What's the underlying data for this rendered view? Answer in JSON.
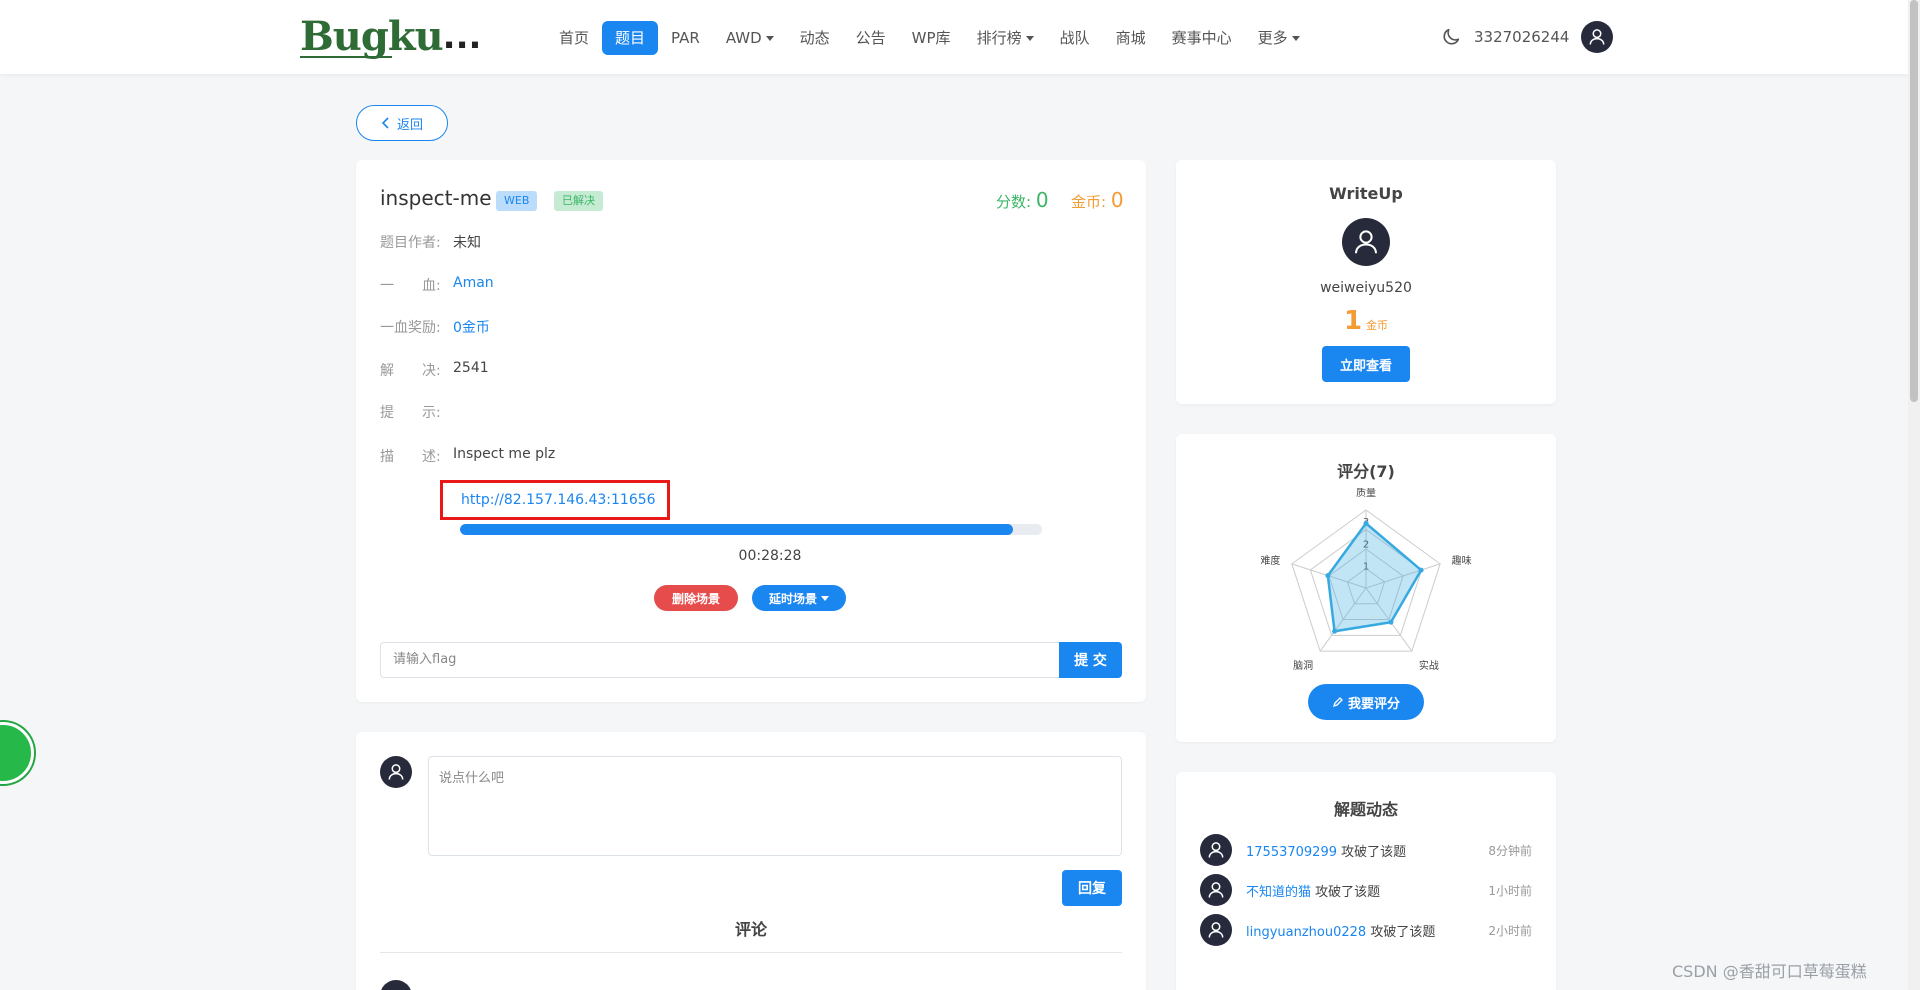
{
  "nav": {
    "logo_text": "Bugku",
    "logo_suffix": "...",
    "items": [
      {
        "label": "首页"
      },
      {
        "label": "题目",
        "active": true
      },
      {
        "label": "PAR"
      },
      {
        "label": "AWD",
        "dropdown": true
      },
      {
        "label": "动态"
      },
      {
        "label": "公告"
      },
      {
        "label": "WP库"
      },
      {
        "label": "排行榜",
        "dropdown": true
      },
      {
        "label": "战队"
      },
      {
        "label": "商城"
      },
      {
        "label": "赛事中心"
      },
      {
        "label": "更多",
        "dropdown": true
      }
    ],
    "username": "3327026244"
  },
  "back_label": "返回",
  "challenge": {
    "title": "inspect-me",
    "category_badge": "WEB",
    "status_badge": "已解决",
    "points_label": "分数: ",
    "points_value": "0",
    "coins_label": "金币: ",
    "coins_value": "0",
    "author_label": "题目作者:",
    "author_value": "未知",
    "blood_label": "一　　血:",
    "blood_value": "Aman",
    "blood_reward_label": "一血奖励:",
    "blood_reward_value": "0金币",
    "solves_label": "解　　决:",
    "solves_value": "2541",
    "hint_label": "提　　示:",
    "hint_value": "",
    "desc_label": "描　　述:",
    "desc_value": "Inspect me plz",
    "url": "http://82.157.146.43:11656",
    "progress_fraction": 0.95,
    "timer": "00:28:28",
    "delete_label": "删除场景",
    "extend_label": "延时场景",
    "flag_placeholder": "请输入flag",
    "submit_label": "提 交"
  },
  "comment": {
    "placeholder": "说点什么吧",
    "reply_label": "回复",
    "section_title": "评论"
  },
  "writeup": {
    "title": "WriteUp",
    "user": "weiweiyu520",
    "coins": "1",
    "coins_unit": "金币",
    "view_label": "立即查看"
  },
  "rating": {
    "title": "评分(7)",
    "rate_label": "我要评分",
    "axes": [
      "质量",
      "趣味",
      "实战",
      "脑洞",
      "难度"
    ],
    "ticks": [
      "1",
      "2",
      "3"
    ],
    "values": [
      2.9,
      2.6,
      1.9,
      2.4,
      1.8
    ],
    "max": 3.5,
    "color": "#36a9e1"
  },
  "activity": {
    "title": "解题动态",
    "items": [
      {
        "user": "17553709299",
        "action": "攻破了该题",
        "time": "8分钟前"
      },
      {
        "user": "不知道的猫",
        "action": "攻破了该题",
        "time": "1小时前"
      },
      {
        "user": "lingyuanzhou0228",
        "action": "攻破了该题",
        "time": "2小时前"
      }
    ]
  },
  "watermark": "CSDN @香甜可口草莓蛋糕"
}
